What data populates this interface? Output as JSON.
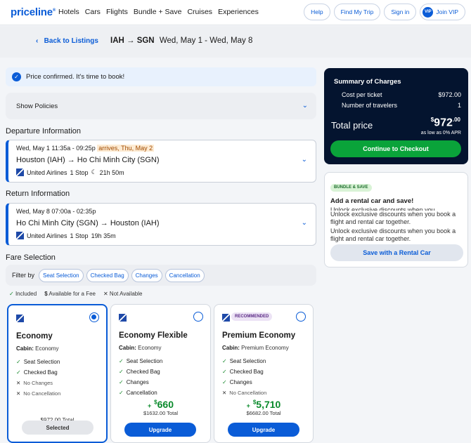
{
  "nav": {
    "logo": "priceline",
    "links": [
      "Hotels",
      "Cars",
      "Flights",
      "Bundle + Save",
      "Cruises",
      "Experiences"
    ],
    "help": "Help",
    "find_trip": "Find My Trip",
    "sign_in": "Sign in",
    "vip_badge": "VIP",
    "join_vip": "Join VIP"
  },
  "subbar": {
    "back": "Back to Listings",
    "route": "IAH → SGN",
    "dates": "Wed, May 1 - Wed, May 8"
  },
  "confirm_msg": "Price confirmed. It's time to book!",
  "policies_label": "Show Policies",
  "departure": {
    "heading": "Departure Information",
    "times": "Wed, May 1   11:35a - 09:25p",
    "arrives": "arrives, Thu, May 2",
    "route": "Houston (IAH)  →  Ho Chi Minh City (SGN)",
    "airline": "United Airlines",
    "stops": "1 Stop",
    "duration": "21h 50m"
  },
  "return": {
    "heading": "Return Information",
    "times": "Wed, May 8   07:00a - 02:35p",
    "route": "Ho Chi Minh City (SGN)  →  Houston (IAH)",
    "airline": "United Airlines",
    "stops": "1 Stop",
    "duration": "19h 35m"
  },
  "fare_selection": {
    "heading": "Fare Selection",
    "filter_label": "Filter by",
    "filters": [
      "Seat Selection",
      "Checked Bag",
      "Changes",
      "Cancellation"
    ],
    "legend": {
      "included": "Included",
      "fee": "Available for a Fee",
      "na": "Not Available"
    },
    "fares": [
      {
        "name": "Economy",
        "cabin_label": "Cabin:",
        "cabin": "Economy",
        "features": [
          {
            "text": "Seat Selection",
            "included": true
          },
          {
            "text": "Checked Bag",
            "included": true
          },
          {
            "text": "No Changes",
            "included": false
          },
          {
            "text": "No Cancellation",
            "included": false
          }
        ],
        "total": "$972.00 Total",
        "button": "Selected",
        "selected": true
      },
      {
        "name": "Economy Flexible",
        "cabin_label": "Cabin:",
        "cabin": "Economy",
        "features": [
          {
            "text": "Seat Selection",
            "included": true
          },
          {
            "text": "Checked Bag",
            "included": true
          },
          {
            "text": "Changes",
            "included": true
          },
          {
            "text": "Cancellation",
            "included": true
          }
        ],
        "plus_sign": "+",
        "dollar": "$",
        "price": "660",
        "total": "$1632.00 Total",
        "button": "Upgrade",
        "selected": false
      },
      {
        "name": "Premium Economy",
        "badge": "RECOMMENDED",
        "cabin_label": "Cabin:",
        "cabin": "Premium Economy",
        "features": [
          {
            "text": "Seat Selection",
            "included": true
          },
          {
            "text": "Checked Bag",
            "included": true
          },
          {
            "text": "Changes",
            "included": true
          },
          {
            "text": "No Cancellation",
            "included": false
          }
        ],
        "plus_sign": "+",
        "dollar": "$",
        "price": "5,710",
        "total": "$6682.00 Total",
        "button": "Upgrade",
        "selected": false
      }
    ]
  },
  "summary": {
    "title": "Summary of Charges",
    "cost_label": "Cost per ticket",
    "cost_value": "$972.00",
    "travelers_label": "Number of travelers",
    "travelers_value": "1",
    "total_label": "Total price",
    "total_dollar": "$",
    "total_main": "972",
    "total_cents": ".00",
    "apr": "as low as 0% APR",
    "checkout": "Continue to Checkout"
  },
  "bundle": {
    "badge": "BUNDLE & SAVE",
    "title": "Add a rental car and save!",
    "text_overlap": "Unlock exclusive discounts when you",
    "text1": "Unlock exclusive discounts when you book a flight and rental car together.",
    "text2": "Unlock exclusive discounts when you book a flight and rental car together.",
    "button": "Save with a Rental Car"
  },
  "colors": {
    "brand": "#0a5cd7",
    "checkout_green": "#0aa33a",
    "summary_bg": "#04142f",
    "price_green": "#0a8a2b"
  }
}
